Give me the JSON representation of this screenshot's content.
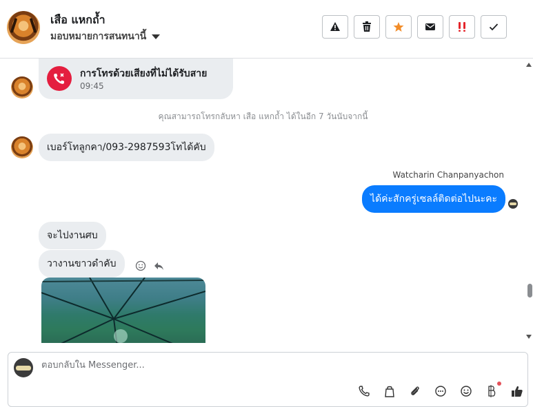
{
  "header": {
    "contact_name": "เสือ แหกถ้ำ",
    "assign_label": "มอบหมายการสนทนานี้",
    "actions": [
      {
        "icon": "warning-icon",
        "glyph": "⚠"
      },
      {
        "icon": "trash-icon",
        "glyph": "🗑"
      },
      {
        "icon": "star-icon",
        "glyph": "★"
      },
      {
        "icon": "mail-icon",
        "glyph": "✉"
      },
      {
        "icon": "spam-icon",
        "glyph": "!!"
      },
      {
        "icon": "check-icon",
        "glyph": "✓"
      }
    ]
  },
  "messages": {
    "missed_call": {
      "title": "การโทรด้วยเสียงที่ไม่ได้รับสาย",
      "time": "09:45",
      "icon": "missed-call-icon"
    },
    "system_note": "คุณสามารถโทรกลับหา เสือ แหกถ้ำ ได้ในอีก 7 วันนับจากนี้",
    "incoming_1": "เบอร์โทลูกคา/093-2987593โทได้คับ",
    "sender_name": "Watcharin Chanpanyachon",
    "outgoing_1": "ได้ค่ะสักครู่เซลล์ติดต่อไปนะคะ",
    "incoming_2": "จะไปงานศบ",
    "incoming_3": "วางานขาวดำคับ"
  },
  "composer": {
    "placeholder": "ตอบกลับใน Messenger...",
    "tools": [
      "phone-icon",
      "bag-icon",
      "paperclip-icon",
      "chat-bubble-icon",
      "emoji-icon",
      "bold-b-icon",
      "thumbs-up-icon"
    ]
  },
  "colors": {
    "outgoing_bubble": "#0a7cff",
    "incoming_bubble": "#eaedf0",
    "missed_call": "#e41e3f",
    "star": "#f28c28"
  }
}
